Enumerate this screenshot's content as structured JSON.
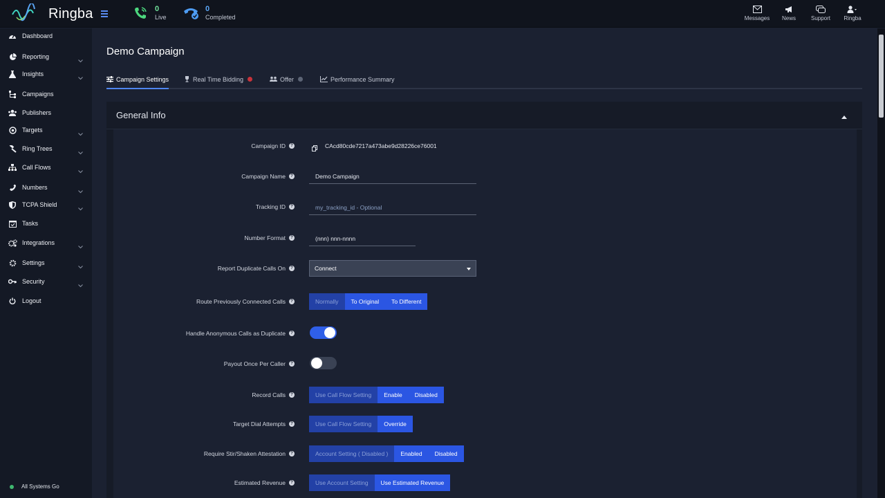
{
  "app": {
    "name": "Ringba"
  },
  "header": {
    "live": {
      "count": "0",
      "label": "Live"
    },
    "completed": {
      "count": "0",
      "label": "Completed"
    },
    "links": [
      {
        "label": "Messages",
        "icon": "envelope-icon"
      },
      {
        "label": "News",
        "icon": "megaphone-icon"
      },
      {
        "label": "Support",
        "icon": "support-chat-icon"
      },
      {
        "label": "Ringba",
        "icon": "user-icon"
      }
    ]
  },
  "sidebar": {
    "items": [
      {
        "label": "Dashboard",
        "icon": "dashboard-icon",
        "expandable": false
      },
      {
        "label": "Reporting",
        "icon": "reporting-icon",
        "expandable": true
      },
      {
        "label": "Insights",
        "icon": "flask-icon",
        "expandable": true
      },
      {
        "label": "Campaigns",
        "icon": "campaigns-icon",
        "expandable": false
      },
      {
        "label": "Publishers",
        "icon": "publishers-icon",
        "expandable": false
      },
      {
        "label": "Targets",
        "icon": "target-icon",
        "expandable": true
      },
      {
        "label": "Ring Trees",
        "icon": "gavel-icon",
        "expandable": true
      },
      {
        "label": "Call Flows",
        "icon": "sitemap-icon",
        "expandable": true
      },
      {
        "label": "Numbers",
        "icon": "phone-icon",
        "expandable": true
      },
      {
        "label": "TCPA Shield",
        "icon": "shield-icon",
        "expandable": true
      },
      {
        "label": "Tasks",
        "icon": "calendar-check-icon",
        "expandable": false
      },
      {
        "label": "Integrations",
        "icon": "cogs-icon",
        "expandable": true
      },
      {
        "label": "Settings",
        "icon": "gear-icon",
        "expandable": true
      },
      {
        "label": "Security",
        "icon": "key-icon",
        "expandable": true
      },
      {
        "label": "Logout",
        "icon": "power-icon",
        "expandable": false
      }
    ],
    "status": "All Systems Go",
    "status_color": "#3fb870"
  },
  "page": {
    "title": "Demo Campaign",
    "tabs": [
      {
        "label": "Campaign Settings",
        "active": true
      },
      {
        "label": "Real Time Bidding",
        "dot_color": "#c8333b"
      },
      {
        "label": "Offer",
        "dot_color": "#5c6475"
      },
      {
        "label": "Performance Summary"
      }
    ]
  },
  "general": {
    "title": "General Info",
    "campaign_id": {
      "label": "Campaign ID",
      "value": "CAcd80cde7217a473abe9d28226ce76001"
    },
    "campaign_name": {
      "label": "Campaign Name",
      "value": "Demo Campaign"
    },
    "tracking_id": {
      "label": "Tracking ID",
      "placeholder": "my_tracking_id - Optional"
    },
    "number_format": {
      "label": "Number Format",
      "value": "(nnn) nnn-nnnn"
    },
    "report_duplicate": {
      "label": "Report Duplicate Calls On",
      "value": "Connect"
    },
    "route_previous": {
      "label": "Route Previously Connected Calls",
      "options": [
        "Normally",
        "To Original",
        "To Different"
      ]
    },
    "handle_anonymous": {
      "label": "Handle Anonymous Calls as Duplicate",
      "on": true
    },
    "payout_once": {
      "label": "Payout Once Per Caller",
      "on": false
    },
    "record_calls": {
      "label": "Record Calls",
      "options": [
        "Use Call Flow Setting",
        "Enable",
        "Disabled"
      ]
    },
    "target_dial": {
      "label": "Target Dial Attempts",
      "options": [
        "Use Call Flow Setting",
        "Override"
      ]
    },
    "stir_shaken": {
      "label": "Require Stir/Shaken Attestation",
      "options": [
        "Account Setting ( Disabled )",
        "Enabled",
        "Disabled"
      ]
    },
    "estimated_revenue": {
      "label": "Estimated Revenue",
      "options": [
        "Use Account Setting",
        "Use Estimated Revenue"
      ]
    }
  }
}
